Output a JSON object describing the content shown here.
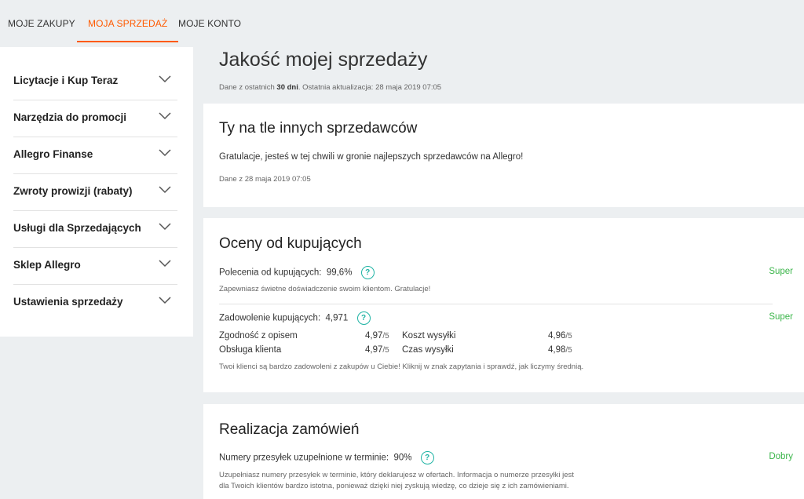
{
  "tabs": [
    {
      "label": "MOJE ZAKUPY"
    },
    {
      "label": "MOJA SPRZEDAŻ",
      "active": true
    },
    {
      "label": "MOJE KONTO"
    }
  ],
  "sidebar": {
    "items": [
      {
        "label": "Licytacje i Kup Teraz"
      },
      {
        "label": "Narzędzia do promocji"
      },
      {
        "label": "Allegro Finanse"
      },
      {
        "label": "Zwroty prowizji (rabaty)"
      },
      {
        "label": "Usługi dla Sprzedających"
      },
      {
        "label": "Sklep Allegro"
      },
      {
        "label": "Ustawienia sprzedaży"
      }
    ]
  },
  "header": {
    "title": "Jakość mojej sprzedaży",
    "sub_prefix": "Dane z ostatnich ",
    "sub_bold": "30 dni",
    "sub_suffix": ". Ostatnia aktualizacja: 28 maja 2019 07:05"
  },
  "compare": {
    "title": "Ty na tle innych sprzedawców",
    "text": "Gratulacje, jesteś w tej chwili w gronie najlepszych sprzedawców na Allegro!",
    "date": "Dane z 28 maja 2019 07:05"
  },
  "ratings": {
    "title": "Oceny od kupujących",
    "recommend_label": "Polecenia od kupujących:",
    "recommend_value": "99,6%",
    "recommend_status": "Super",
    "recommend_note": "Zapewniasz świetne doświadczenie swoim klientom. Gratulacje!",
    "satisfaction_label": "Zadowolenie kupujących:",
    "satisfaction_value": "4,971",
    "satisfaction_status": "Super",
    "denominator": "/5",
    "details": [
      {
        "label": "Zgodność z opisem",
        "value": "4,97"
      },
      {
        "label": "Obsługa klienta",
        "value": "4,97"
      },
      {
        "label": "Koszt wysyłki",
        "value": "4,96"
      },
      {
        "label": "Czas wysyłki",
        "value": "4,98"
      }
    ],
    "satisfaction_note": "Twoi klienci są bardzo zadowoleni z zakupów u Ciebie! Kliknij w znak zapytania i sprawdź, jak liczymy średnią."
  },
  "orders": {
    "title": "Realizacja zamówień",
    "tracking_label": "Numery przesyłek uzupełnione w terminie:",
    "tracking_value": "90%",
    "tracking_status": "Dobry",
    "tracking_note_1": "Uzupełniasz numery przesyłek w terminie, który deklarujesz w ofertach. Informacja o numerze przesyłki jest",
    "tracking_note_2": "dla Twoich klientów bardzo istotna, ponieważ dzięki niej zyskują wiedzę, co dzieje się z ich zamówieniami."
  },
  "icons": {
    "help": "question-circle-icon",
    "chevron": "chevron-down-icon"
  },
  "colors": {
    "accent": "#ff5a00",
    "good": "#3bb54a",
    "help": "#1fb3a4"
  }
}
